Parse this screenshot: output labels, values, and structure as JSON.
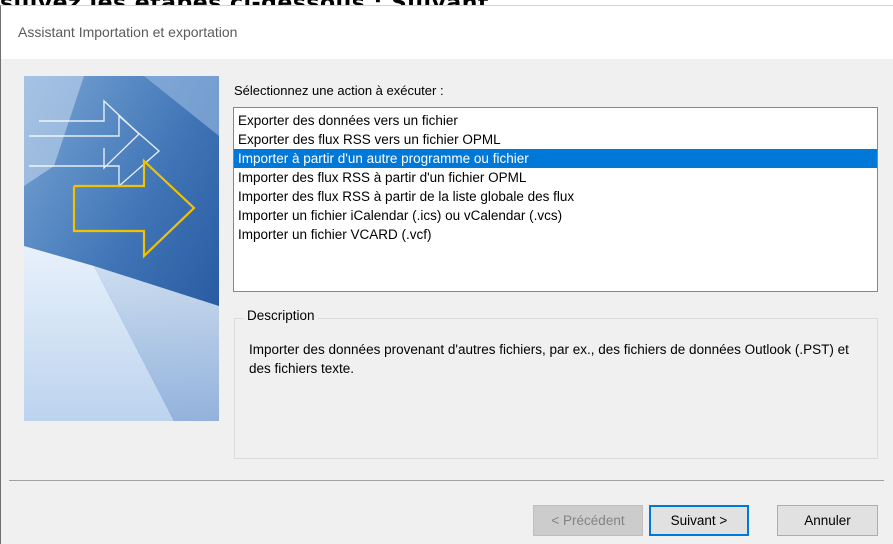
{
  "background_partial_text": "suivez les étapes ci-dessous : Suivant",
  "dialog": {
    "title": "Assistant Importation et exportation"
  },
  "main": {
    "action_label": "Sélectionnez une action à exécuter :",
    "actions": [
      {
        "label": "Exporter des données vers un fichier",
        "selected": false
      },
      {
        "label": "Exporter des flux RSS vers un fichier OPML",
        "selected": false
      },
      {
        "label": "Importer à partir d'un autre programme ou fichier",
        "selected": true
      },
      {
        "label": "Importer des flux RSS à partir d'un fichier OPML",
        "selected": false
      },
      {
        "label": "Importer des flux RSS à partir de la liste globale des flux",
        "selected": false
      },
      {
        "label": "Importer un fichier iCalendar (.ics) ou vCalendar (.vcs)",
        "selected": false
      },
      {
        "label": "Importer un fichier VCARD (.vcf)",
        "selected": false
      }
    ],
    "description_title": "Description",
    "description_text": "Importer des données provenant d'autres fichiers, par ex., des fichiers de données Outlook (.PST) et des fichiers texte."
  },
  "buttons": {
    "previous": "< Précédent",
    "next": "Suivant >",
    "cancel": "Annuler"
  },
  "colors": {
    "selection": "#0078d7",
    "dialog_bg": "#f0f0f0",
    "arrow_accent": "#f2c200"
  },
  "icons": [
    "wizard-arrow-illustration"
  ]
}
